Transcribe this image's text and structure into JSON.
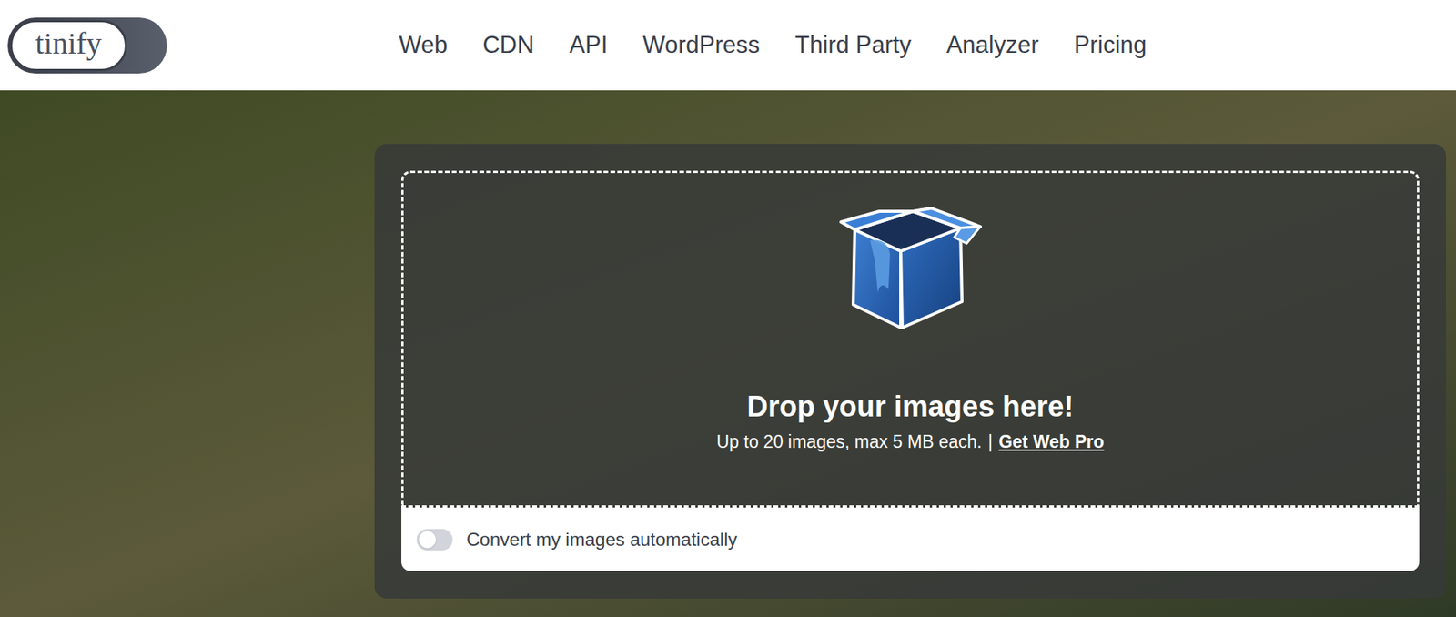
{
  "logo": {
    "text": "tinify"
  },
  "nav": {
    "items": [
      {
        "label": "Web"
      },
      {
        "label": "CDN"
      },
      {
        "label": "API"
      },
      {
        "label": "WordPress"
      },
      {
        "label": "Third Party"
      },
      {
        "label": "Analyzer"
      },
      {
        "label": "Pricing"
      }
    ]
  },
  "dropzone": {
    "title": "Drop your images here!",
    "subtitle": "Up to 20 images, max 5 MB each.",
    "separator": "|",
    "link": "Get Web Pro"
  },
  "options": {
    "convert": {
      "label": "Convert my images automatically",
      "on": false
    }
  }
}
